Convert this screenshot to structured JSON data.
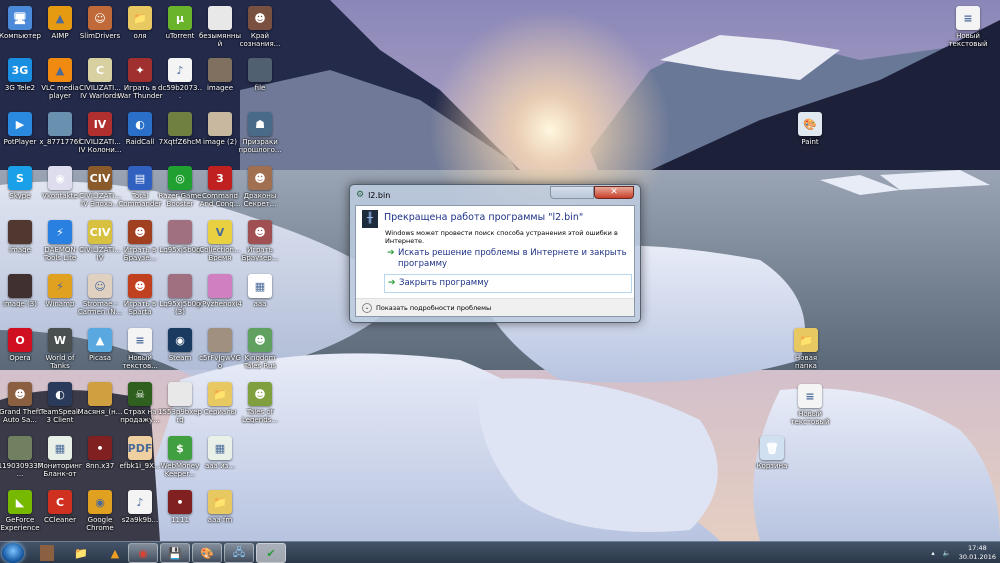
{
  "desktop": {
    "grid": [
      [
        [
          "Компьютер",
          "#4a8ad8",
          "🖥"
        ],
        [
          "AIMP",
          "#e69a12",
          "▲"
        ],
        [
          "SlimDrivers",
          "#c06a3a",
          "☺"
        ],
        [
          "оля",
          "#e8c860",
          "📁"
        ],
        [
          "uTorrent",
          "#6ab42c",
          "µ"
        ],
        [
          "безымянный",
          "#e8e8e8",
          ""
        ],
        [
          "Край сознания...",
          "#7a5040",
          "☻"
        ]
      ],
      [
        [
          "3G Tele2",
          "#1a8ee0",
          "3G"
        ],
        [
          "VLC media player",
          "#f08a10",
          "▲"
        ],
        [
          "CIVILIZATI... IV Warlords",
          "#d8d0a0",
          "C"
        ],
        [
          "Играть в War Thunder",
          "#a03030",
          "✦"
        ],
        [
          "dc59b2073...",
          "#f4f4f4",
          "♪"
        ],
        [
          "imagee",
          "#807060",
          ""
        ],
        [
          "file",
          "#506070",
          ""
        ]
      ],
      [
        [
          "PotPlayer",
          "#2a8ae0",
          "▶"
        ],
        [
          "x_8771776f",
          "#6a90b0",
          ""
        ],
        [
          "CIVILIZATI... IV Колони...",
          "#b03030",
          "IV"
        ],
        [
          "RaidCall",
          "#2a70c8",
          "◐"
        ],
        [
          "7XqtfZ6hcM",
          "#708040",
          ""
        ],
        [
          "image (2)",
          "#c8b8a0",
          ""
        ],
        [
          "Призраки прошлого...",
          "#4a6a8a",
          "☗"
        ]
      ],
      [
        [
          "Skype",
          "#1aa0e8",
          "S"
        ],
        [
          "Vkontakte",
          "#dde",
          "◉"
        ],
        [
          "CIVILIZATI... IV Эпоха...",
          "#8a5a2a",
          "CIV"
        ],
        [
          "Total Commander",
          "#3060c0",
          "▤"
        ],
        [
          "Razer Game Booster",
          "#20a030",
          "◎"
        ],
        [
          "Command And Conq...",
          "#c02020",
          "3"
        ],
        [
          "Драконы Секрет...",
          "#a07050",
          "☻"
        ]
      ],
      [
        [
          "image",
          "#503830",
          ""
        ],
        [
          "DAEMON Tools Lite",
          "#2a80e0",
          "⚡"
        ],
        [
          "CIVILIZATI... IV",
          "#d8c040",
          "CIV"
        ],
        [
          "Играть в Браузе...",
          "#a04020",
          "☻"
        ],
        [
          "Lq95xj5b0g",
          "#a07080",
          ""
        ],
        [
          "Collection... Время",
          "#e8d040",
          "V"
        ],
        [
          "Играть Браузер...",
          "#a05050",
          "☻"
        ]
      ],
      [
        [
          "image (3)",
          "#403030",
          ""
        ],
        [
          "Winamp",
          "#e0a020",
          "⚡"
        ],
        [
          "Stromae - Carmen (N...",
          "#e0d0c0",
          "☺"
        ],
        [
          "Играть в Sparta",
          "#c04020",
          "☻"
        ],
        [
          "Lq95xj5b0g (3)",
          "#a07080",
          ""
        ],
        [
          "xPyzhenoxi4",
          "#d080c0",
          ""
        ],
        [
          "ааа",
          "#ffffff",
          "▦"
        ]
      ],
      [
        [
          "Opera",
          "#d01020",
          "O"
        ],
        [
          "World of Tanks",
          "#4a5050",
          "W"
        ],
        [
          "Picasa",
          "#5aa8e0",
          "▲"
        ],
        [
          "Новый текстов...",
          "#f4f4f4",
          "≡"
        ],
        [
          "Steam",
          "#1a3a60",
          "◉"
        ],
        [
          "c5rFvJgwVGo",
          "#a09080",
          ""
        ],
        [
          "Kingdom Tales Rus",
          "#60a060",
          "☻"
        ]
      ],
      [
        [
          "Grand Theft Auto Sa...",
          "#8a6040",
          "☻"
        ],
        [
          "TeamSpeak 3 Client",
          "#2a3a5a",
          "◐"
        ],
        [
          "Масяня_(н...",
          "#d0a040",
          ""
        ],
        [
          "Страх на продажу...",
          "#306020",
          "☠"
        ],
        [
          "1553p9bxeprg",
          "#e8e8e8",
          ""
        ],
        [
          "Сериалы",
          "#e8c860",
          "📁"
        ],
        [
          "Tales of Legends...",
          "#80a040",
          "☻"
        ]
      ],
      [
        [
          "1190309337...",
          "#708060",
          ""
        ],
        [
          "Мониторинг Бланк-от",
          "#e8f0e8",
          "▦"
        ],
        [
          "8nn.x37",
          "#802020",
          "•"
        ],
        [
          "efbk1i_9X...",
          "#f0d0a0",
          "PDF"
        ],
        [
          "WebMoney Keeper...",
          "#40a040",
          "$"
        ],
        [
          "ааа из...",
          "#e8f0e8",
          "▦"
        ]
      ],
      [
        [
          "GeForce Experience",
          "#76b900",
          "◣"
        ],
        [
          "CCleaner",
          "#d03020",
          "C"
        ],
        [
          "Google Chrome",
          "#e0a020",
          "◉"
        ],
        [
          "s2a9k9b...",
          "#f4f4f4",
          "♪"
        ],
        [
          "1111",
          "#802020",
          "•"
        ],
        [
          "ааа fm",
          "#e8c860",
          "📁"
        ]
      ]
    ],
    "right_icons": [
      [
        "Новый текстовый ...",
        "#f4f4f4",
        "≡"
      ],
      [
        "Paint",
        "#e0e8f0",
        "🎨"
      ],
      [
        "Новая папка",
        "#e8c860",
        "📁"
      ],
      [
        "Новый текстовый ...",
        "#f4f4f4",
        "≡"
      ],
      [
        "Корзина",
        "#d0e0f0",
        "🗑"
      ]
    ]
  },
  "dialog": {
    "window_title": "l2.bin",
    "close_glyph": "✕",
    "heading": "Прекращена работа программы \"l2.bin\"",
    "description": "Windows может провести поиск способа устранения этой ошибки в Интернете.",
    "option_search": "Искать решение проблемы в Интернете и закрыть программу",
    "option_close": "Закрыть программу",
    "details_toggle": "Показать подробности проблемы"
  },
  "taskbar": {
    "items": [
      "person",
      "explorer",
      "AIMP",
      "Chrome",
      "save",
      "paint",
      "network",
      "check"
    ],
    "time": "17:48",
    "date": "30.01.2016"
  }
}
